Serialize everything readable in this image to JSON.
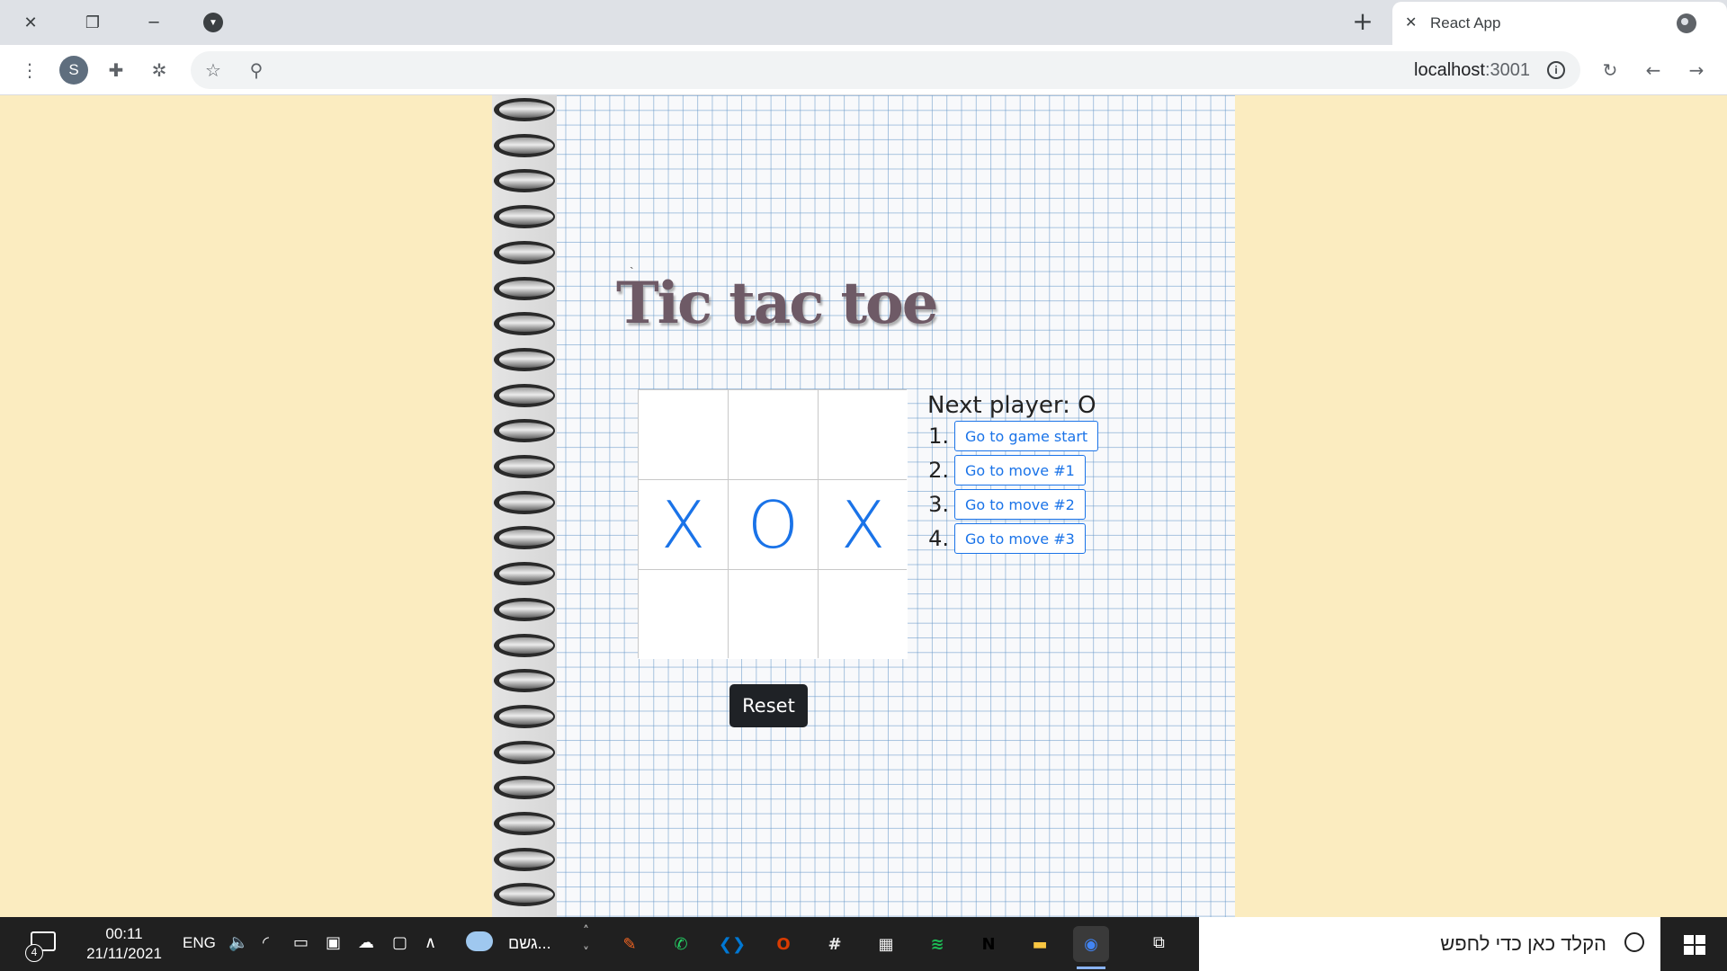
{
  "browser": {
    "tab_title": "React App",
    "url_host": "localhost",
    "url_port": ":3001",
    "profile_initial": "S",
    "icons": [
      "close-icon",
      "restore-icon",
      "minimize-icon",
      "tab-search-icon",
      "new-tab-icon",
      "globe-icon",
      "menu-icon",
      "extensions-icon",
      "bug-extension-icon",
      "bookmark-star-icon",
      "zoom-search-icon",
      "site-info-icon",
      "reload-icon",
      "back-icon",
      "forward-icon"
    ]
  },
  "game": {
    "title": "Tic tac toe",
    "board": [
      "",
      "",
      "",
      "X",
      "O",
      "X",
      "",
      "",
      ""
    ],
    "status": "Next player: O",
    "moves": [
      {
        "num": "1.",
        "label": "Go to game start"
      },
      {
        "num": "2.",
        "label": "Go to move #1"
      },
      {
        "num": "3.",
        "label": "Go to move #2"
      },
      {
        "num": "4.",
        "label": "Go to move #3"
      }
    ],
    "reset_label": "Reset",
    "mark_color": "#1a73e8",
    "background_color": "#fbecc0"
  },
  "taskbar": {
    "notification_count": "4",
    "time": "00:11",
    "date": "21/11/2021",
    "language": "ENG",
    "weather_text": "גשם...",
    "search_placeholder": "הקלד כאן כדי לחפש",
    "apps": [
      {
        "name": "pen-app-icon",
        "color": "#f26522",
        "glyph": "✎"
      },
      {
        "name": "whatsapp-icon",
        "color": "#25d366",
        "glyph": "✆"
      },
      {
        "name": "vscode-icon",
        "color": "#0078d4",
        "glyph": "❮❯"
      },
      {
        "name": "office-icon",
        "color": "#d83b01",
        "glyph": "O"
      },
      {
        "name": "slack-icon",
        "color": "#e8e8e8",
        "glyph": "#"
      },
      {
        "name": "store-icon",
        "color": "#f3f3f3",
        "glyph": "▦"
      },
      {
        "name": "spotify-icon",
        "color": "#1db954",
        "glyph": "≋"
      },
      {
        "name": "netflix-icon",
        "color": "#000000",
        "glyph": "N"
      },
      {
        "name": "file-explorer-icon",
        "color": "#f8c642",
        "glyph": "▬"
      },
      {
        "name": "chrome-icon",
        "color": "#4285f4",
        "glyph": "◉"
      }
    ]
  }
}
